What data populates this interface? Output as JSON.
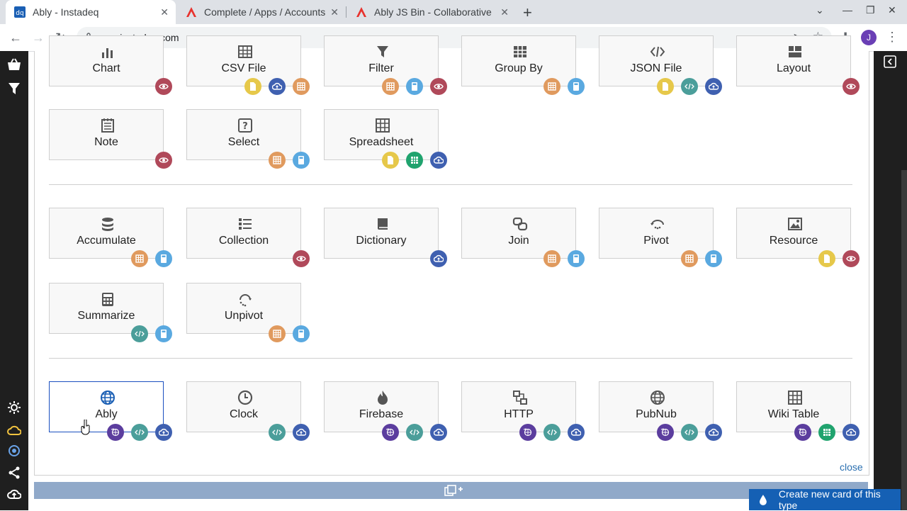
{
  "browser": {
    "tabs": [
      {
        "label": "Ably - Instadeq",
        "favicon": "dq",
        "active": true
      },
      {
        "label": "Complete / Apps / Accounts",
        "favicon": "ably-logo",
        "active": false
      },
      {
        "label": "Ably JS Bin - Collaborative",
        "favicon": "ably-logo",
        "active": false
      }
    ],
    "close_glyph": "✕",
    "new_tab_glyph": "+",
    "url": "app.instadeq.com",
    "avatar_letter": "J"
  },
  "colors": {
    "yellow": "#e6c84a",
    "blue": "#3f60b0",
    "orange": "#e09a5e",
    "light_blue": "#5aa9e0",
    "red": "#b0495a",
    "teal": "#4b9e9a",
    "green": "#20a36e",
    "purple": "#5b3d9e",
    "primary": "#1560b4"
  },
  "cards": [
    {
      "label": "Chart",
      "icon": "chart-icon",
      "badges": [
        "red"
      ]
    },
    {
      "label": "CSV File",
      "icon": "csv-file-icon",
      "badges": [
        "yellow",
        "blue",
        "orange"
      ]
    },
    {
      "label": "Filter",
      "icon": "filter-icon",
      "badges": [
        "orange",
        "light_blue",
        "red"
      ]
    },
    {
      "label": "Group By",
      "icon": "group-by-icon",
      "badges": [
        "orange",
        "light_blue"
      ]
    },
    {
      "label": "JSON File",
      "icon": "json-file-icon",
      "badges": [
        "yellow",
        "teal",
        "blue"
      ]
    },
    {
      "label": "Layout",
      "icon": "layout-icon",
      "badges": [
        "red"
      ]
    },
    {
      "label": "Note",
      "icon": "note-icon",
      "badges": [
        "red"
      ]
    },
    {
      "label": "Select",
      "icon": "select-icon",
      "badges": [
        "orange",
        "light_blue"
      ]
    },
    {
      "label": "Spreadsheet",
      "icon": "spreadsheet-icon",
      "badges": [
        "yellow",
        "green",
        "blue"
      ]
    },
    {
      "label": "Accumulate",
      "icon": "accumulate-icon",
      "badges": [
        "orange",
        "light_blue"
      ]
    },
    {
      "label": "Collection",
      "icon": "collection-icon",
      "badges": [
        "red"
      ]
    },
    {
      "label": "Dictionary",
      "icon": "dictionary-icon",
      "badges": [
        "blue"
      ]
    },
    {
      "label": "Join",
      "icon": "join-icon",
      "badges": [
        "orange",
        "light_blue"
      ]
    },
    {
      "label": "Pivot",
      "icon": "pivot-icon",
      "badges": [
        "orange",
        "light_blue"
      ]
    },
    {
      "label": "Resource",
      "icon": "resource-icon",
      "badges": [
        "yellow",
        "red"
      ]
    },
    {
      "label": "Summarize",
      "icon": "summarize-icon",
      "badges": [
        "teal",
        "light_blue"
      ]
    },
    {
      "label": "Unpivot",
      "icon": "unpivot-icon",
      "badges": [
        "orange",
        "light_blue"
      ]
    },
    {
      "label": "Ably",
      "icon": "ably-globe-icon",
      "badges": [
        "purple",
        "teal",
        "blue"
      ],
      "selected": true
    },
    {
      "label": "Clock",
      "icon": "clock-icon",
      "badges": [
        "teal",
        "blue"
      ]
    },
    {
      "label": "Firebase",
      "icon": "firebase-icon",
      "badges": [
        "purple",
        "teal",
        "blue"
      ]
    },
    {
      "label": "HTTP",
      "icon": "http-icon",
      "badges": [
        "purple",
        "teal",
        "blue"
      ]
    },
    {
      "label": "PubNub",
      "icon": "pubnub-globe-icon",
      "badges": [
        "purple",
        "teal",
        "blue"
      ]
    },
    {
      "label": "Wiki Table",
      "icon": "wiki-table-icon",
      "badges": [
        "purple",
        "green",
        "blue"
      ]
    }
  ],
  "close_link": "close",
  "create_button": "Create new card of this type"
}
